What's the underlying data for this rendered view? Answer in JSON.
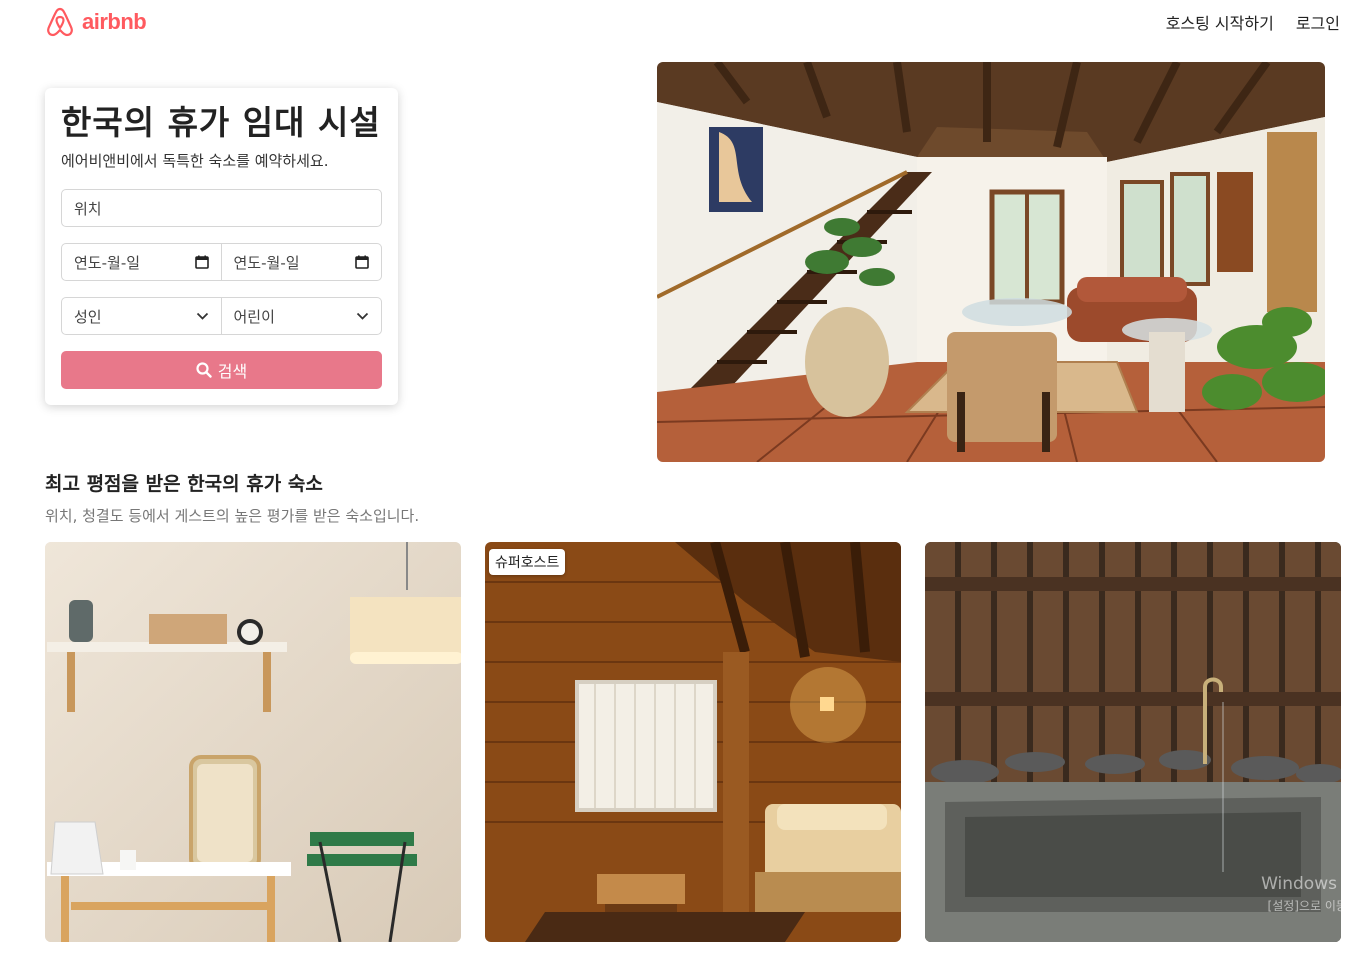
{
  "header": {
    "logo_text": "airbnb",
    "nav": {
      "host": "호스팅 시작하기",
      "login": "로그인"
    }
  },
  "search": {
    "title": "한국의 휴가 임대 시설",
    "subtitle": "에어비앤비에서 독특한 숙소를 예약하세요.",
    "location_placeholder": "위치",
    "checkin_placeholder": "연도-월-일",
    "checkout_placeholder": "연도-월-일",
    "adults_label": "성인",
    "children_label": "어린이",
    "button_label": "검색"
  },
  "section": {
    "title": "최고 평점을 받은 한국의 휴가 숙소",
    "subtitle": "위치, 청결도 등에서 게스트의 높은 평가를 받은 숙소입니다."
  },
  "listings": [
    {
      "badge": ""
    },
    {
      "badge": "슈퍼호스트"
    },
    {
      "badge": ""
    }
  ],
  "watermark": {
    "line1": "Windows 정",
    "line2": "[설정]으로 이동하"
  },
  "colors": {
    "brand": "#ff5a5f",
    "button": "#e8788a"
  }
}
